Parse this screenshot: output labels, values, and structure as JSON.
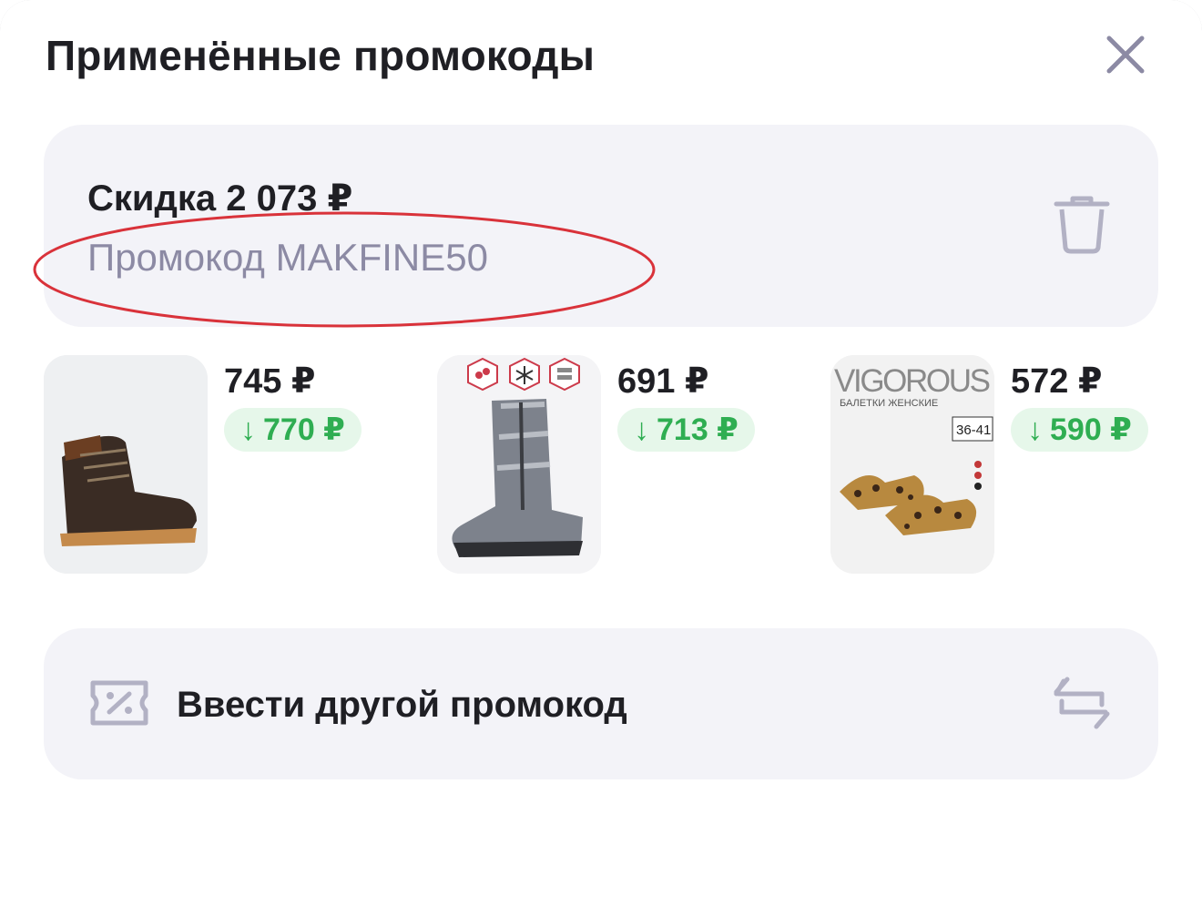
{
  "sheet": {
    "title": "Применённые промокоды"
  },
  "applied_promo": {
    "discount_label": "Скидка 2 073 ₽",
    "promo_code_label": "Промокод MAKFINE50"
  },
  "products": [
    {
      "price": "745 ₽",
      "old_price": "770 ₽",
      "image": "brown-lace-up-boot"
    },
    {
      "price": "691 ₽",
      "old_price": "713 ₽",
      "image": "silver-puffer-boot",
      "badges": [
        "drops-icon",
        "snowflake-icon",
        "layers-icon"
      ]
    },
    {
      "price": "572 ₽",
      "old_price": "590 ₽",
      "image": "leopard-ballet-flats",
      "brand": "VIGOROUS",
      "subtitle": "БАЛЕТКИ ЖЕНСКИЕ",
      "size_range": "36-41"
    }
  ],
  "enter_other": {
    "label": "Ввести другой промокод"
  },
  "icons": {
    "close": "close-icon",
    "trash": "trash-icon",
    "coupon": "coupon-percent-icon",
    "swap": "swap-arrows-icon"
  },
  "colors": {
    "accent_green": "#2fae52",
    "green_bg": "#e6f7ea",
    "muted_text": "#8c8aa4",
    "card_bg": "#f3f3f8",
    "highlight_red": "#d9323a"
  }
}
